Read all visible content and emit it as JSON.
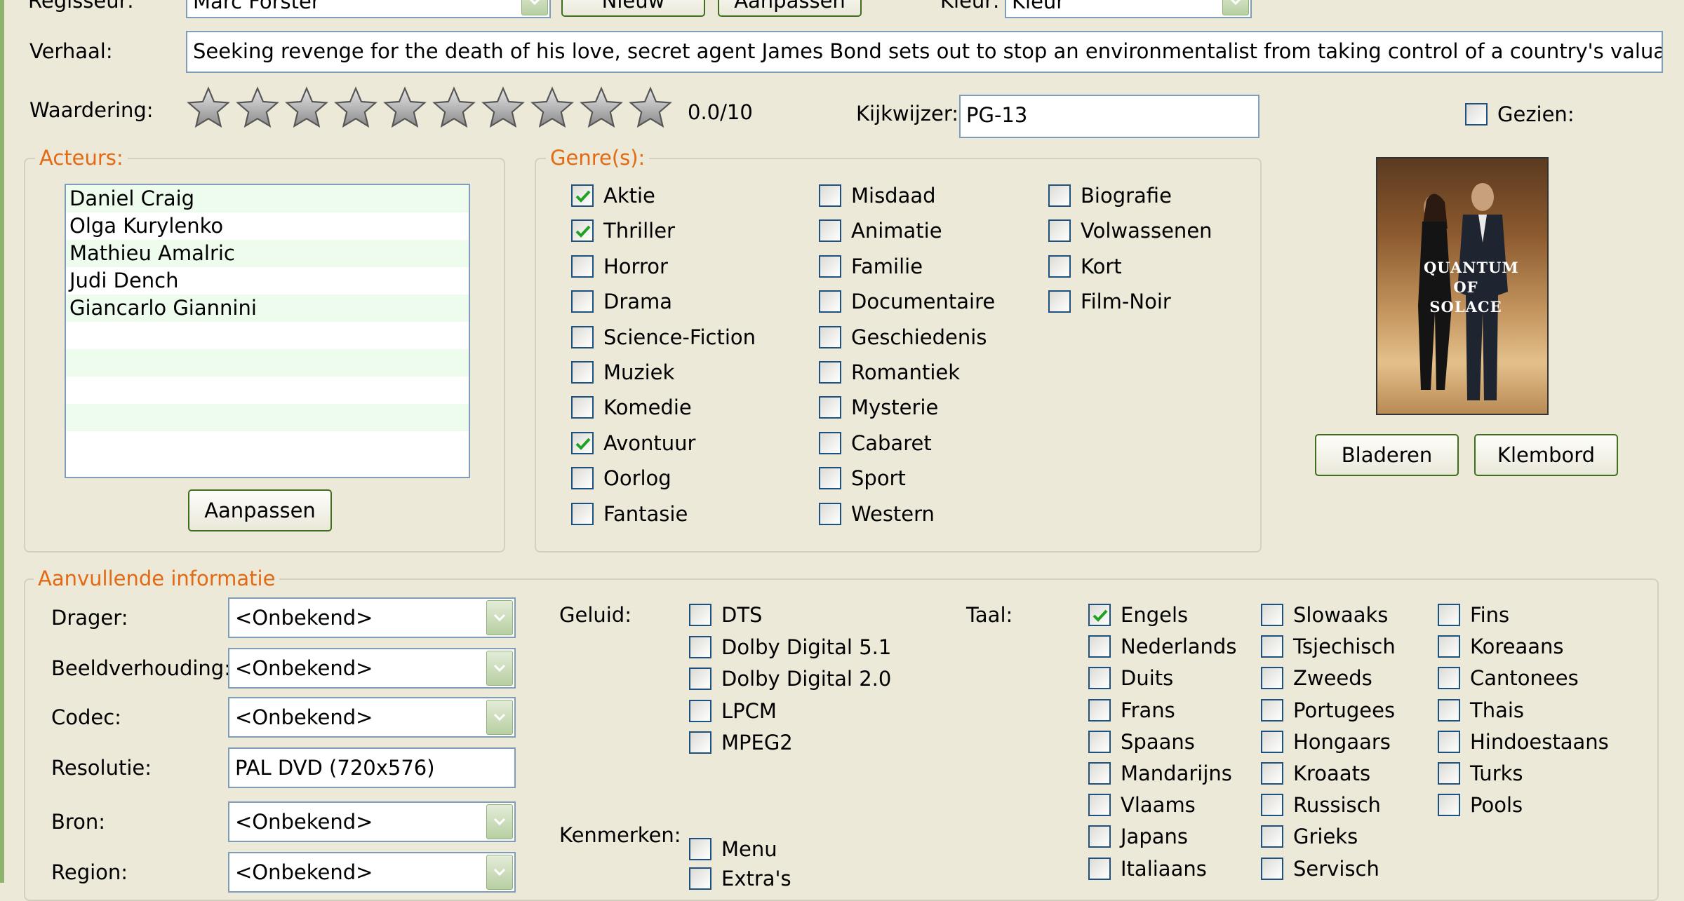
{
  "top": {
    "regisseur_label": "Regisseur:",
    "regisseur_value": "Marc Forster",
    "new_button": "Nieuw",
    "edit_button": "Aanpassen",
    "kleur_label": "Kleur:",
    "kleur_value": "Kleur"
  },
  "verhaal": {
    "label": "Verhaal:",
    "value": "Seeking revenge for the death of his love, secret agent James Bond sets out to stop an environmentalist from taking control of a country's valuable resource."
  },
  "rating": {
    "label": "Waardering:",
    "stars_total": 10,
    "stars_filled": 0,
    "value_text": "0.0/10"
  },
  "kijkwijzer": {
    "label": "Kijkwijzer:",
    "value": "PG-13"
  },
  "gezien": {
    "label": "Gezien:",
    "checked": false
  },
  "actors": {
    "title": "Acteurs:",
    "items": [
      "Daniel Craig",
      "Olga Kurylenko",
      "Mathieu Amalric",
      "Judi Dench",
      "Giancarlo Giannini"
    ],
    "edit_button": "Aanpassen"
  },
  "genres": {
    "title": "Genre(s):",
    "items": [
      {
        "label": "Aktie",
        "checked": true
      },
      {
        "label": "Thriller",
        "checked": true
      },
      {
        "label": "Horror",
        "checked": false
      },
      {
        "label": "Drama",
        "checked": false
      },
      {
        "label": "Science-Fiction",
        "checked": false
      },
      {
        "label": "Muziek",
        "checked": false
      },
      {
        "label": "Komedie",
        "checked": false
      },
      {
        "label": "Avontuur",
        "checked": true
      },
      {
        "label": "Oorlog",
        "checked": false
      },
      {
        "label": "Fantasie",
        "checked": false
      },
      {
        "label": "Misdaad",
        "checked": false
      },
      {
        "label": "Animatie",
        "checked": false
      },
      {
        "label": "Familie",
        "checked": false
      },
      {
        "label": "Documentaire",
        "checked": false
      },
      {
        "label": "Geschiedenis",
        "checked": false
      },
      {
        "label": "Romantiek",
        "checked": false
      },
      {
        "label": "Mysterie",
        "checked": false
      },
      {
        "label": "Cabaret",
        "checked": false
      },
      {
        "label": "Sport",
        "checked": false
      },
      {
        "label": "Western",
        "checked": false
      },
      {
        "label": "Biografie",
        "checked": false
      },
      {
        "label": "Volwassenen",
        "checked": false
      },
      {
        "label": "Kort",
        "checked": false
      },
      {
        "label": "Film-Noir",
        "checked": false
      }
    ]
  },
  "poster": {
    "logo_text": "QUANTUM OF SOLACE",
    "browse_button": "Bladeren",
    "clipboard_button": "Klembord"
  },
  "extra": {
    "title": "Aanvullende informatie",
    "fields": [
      {
        "label": "Drager:",
        "value": "<Onbekend>"
      },
      {
        "label": "Beeldverhouding:",
        "value": "<Onbekend>"
      },
      {
        "label": "Codec:",
        "value": "<Onbekend>"
      },
      {
        "label": "Resolutie:",
        "value": "PAL DVD (720x576)"
      },
      {
        "label": "Bron:",
        "value": "<Onbekend>"
      },
      {
        "label": "Region:",
        "value": "<Onbekend>"
      }
    ],
    "geluid_label": "Geluid:",
    "geluid": [
      {
        "label": "DTS",
        "checked": false
      },
      {
        "label": "Dolby Digital 5.1",
        "checked": false
      },
      {
        "label": "Dolby Digital 2.0",
        "checked": false
      },
      {
        "label": "LPCM",
        "checked": false
      },
      {
        "label": "MPEG2",
        "checked": false
      }
    ],
    "kenmerken_label": "Kenmerken:",
    "kenmerken": [
      {
        "label": "Menu",
        "checked": false
      },
      {
        "label": "Extra's",
        "checked": false
      }
    ],
    "taal_label": "Taal:",
    "talen": [
      {
        "label": "Engels",
        "checked": true
      },
      {
        "label": "Nederlands",
        "checked": false
      },
      {
        "label": "Duits",
        "checked": false
      },
      {
        "label": "Frans",
        "checked": false
      },
      {
        "label": "Spaans",
        "checked": false
      },
      {
        "label": "Mandarijns",
        "checked": false
      },
      {
        "label": "Vlaams",
        "checked": false
      },
      {
        "label": "Japans",
        "checked": false
      },
      {
        "label": "Italiaans",
        "checked": false
      },
      {
        "label": "Slowaaks",
        "checked": false
      },
      {
        "label": "Tsjechisch",
        "checked": false
      },
      {
        "label": "Zweeds",
        "checked": false
      },
      {
        "label": "Portugees",
        "checked": false
      },
      {
        "label": "Hongaars",
        "checked": false
      },
      {
        "label": "Kroaats",
        "checked": false
      },
      {
        "label": "Russisch",
        "checked": false
      },
      {
        "label": "Grieks",
        "checked": false
      },
      {
        "label": "Servisch",
        "checked": false
      },
      {
        "label": "Fins",
        "checked": false
      },
      {
        "label": "Koreaans",
        "checked": false
      },
      {
        "label": "Cantonees",
        "checked": false
      },
      {
        "label": "Thais",
        "checked": false
      },
      {
        "label": "Hindoestaans",
        "checked": false
      },
      {
        "label": "Turks",
        "checked": false
      },
      {
        "label": "Pools",
        "checked": false
      }
    ]
  },
  "colors": {
    "background": "#ece9d8",
    "group_title": "#e46912",
    "check_green": "#21a121",
    "field_border": "#7f9db9"
  }
}
